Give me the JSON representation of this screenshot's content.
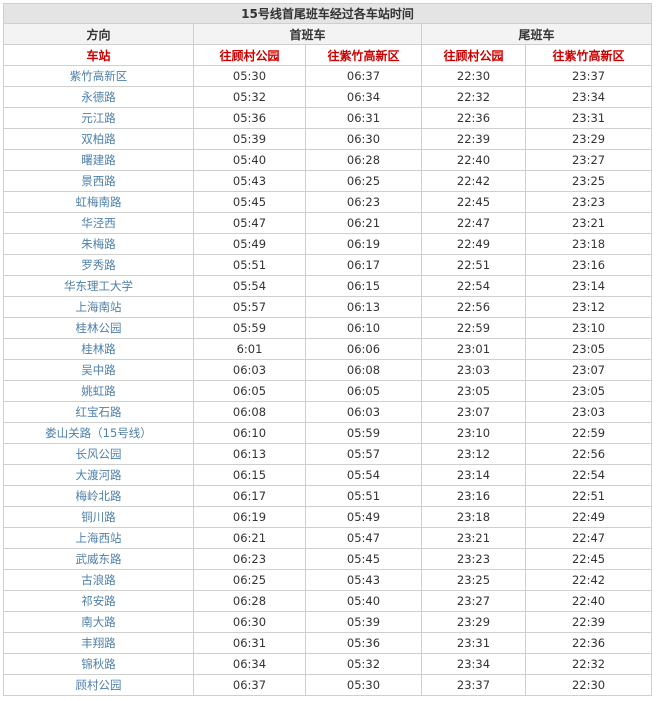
{
  "title": "15号线首尾班车经过各车站时间",
  "header": {
    "direction": "方向",
    "first_train": "首班车",
    "last_train": "尾班车"
  },
  "subheader": {
    "station": "车站",
    "to_gucun": "往顾村公园",
    "to_zizhu": "往紫竹高新区"
  },
  "rows": [
    {
      "station": "紫竹高新区",
      "first_gucun": "05:30",
      "first_zizhu": "06:37",
      "last_gucun": "22:30",
      "last_zizhu": "23:37"
    },
    {
      "station": "永德路",
      "first_gucun": "05:32",
      "first_zizhu": "06:34",
      "last_gucun": "22:32",
      "last_zizhu": "23:34"
    },
    {
      "station": "元江路",
      "first_gucun": "05:36",
      "first_zizhu": "06:31",
      "last_gucun": "22:36",
      "last_zizhu": "23:31"
    },
    {
      "station": "双柏路",
      "first_gucun": "05:39",
      "first_zizhu": "06:30",
      "last_gucun": "22:39",
      "last_zizhu": "23:29"
    },
    {
      "station": "曙建路",
      "first_gucun": "05:40",
      "first_zizhu": "06:28",
      "last_gucun": "22:40",
      "last_zizhu": "23:27"
    },
    {
      "station": "景西路",
      "first_gucun": "05:43",
      "first_zizhu": "06:25",
      "last_gucun": "22:42",
      "last_zizhu": "23:25"
    },
    {
      "station": "虹梅南路",
      "first_gucun": "05:45",
      "first_zizhu": "06:23",
      "last_gucun": "22:45",
      "last_zizhu": "23:23"
    },
    {
      "station": "华泾西",
      "first_gucun": "05:47",
      "first_zizhu": "06:21",
      "last_gucun": "22:47",
      "last_zizhu": "23:21"
    },
    {
      "station": "朱梅路",
      "first_gucun": "05:49",
      "first_zizhu": "06:19",
      "last_gucun": "22:49",
      "last_zizhu": "23:18"
    },
    {
      "station": "罗秀路",
      "first_gucun": "05:51",
      "first_zizhu": "06:17",
      "last_gucun": "22:51",
      "last_zizhu": "23:16"
    },
    {
      "station": "华东理工大学",
      "first_gucun": "05:54",
      "first_zizhu": "06:15",
      "last_gucun": "22:54",
      "last_zizhu": "23:14"
    },
    {
      "station": "上海南站",
      "first_gucun": "05:57",
      "first_zizhu": "06:13",
      "last_gucun": "22:56",
      "last_zizhu": "23:12"
    },
    {
      "station": "桂林公园",
      "first_gucun": "05:59",
      "first_zizhu": "06:10",
      "last_gucun": "22:59",
      "last_zizhu": "23:10"
    },
    {
      "station": "桂林路",
      "first_gucun": "6:01",
      "first_zizhu": "06:06",
      "last_gucun": "23:01",
      "last_zizhu": "23:05"
    },
    {
      "station": "吴中路",
      "first_gucun": "06:03",
      "first_zizhu": "06:08",
      "last_gucun": "23:03",
      "last_zizhu": "23:07"
    },
    {
      "station": "姚虹路",
      "first_gucun": "06:05",
      "first_zizhu": "06:05",
      "last_gucun": "23:05",
      "last_zizhu": "23:05"
    },
    {
      "station": "红宝石路",
      "first_gucun": "06:08",
      "first_zizhu": "06:03",
      "last_gucun": "23:07",
      "last_zizhu": "23:03"
    },
    {
      "station": "娄山关路（15号线）",
      "first_gucun": "06:10",
      "first_zizhu": "05:59",
      "last_gucun": "23:10",
      "last_zizhu": "22:59"
    },
    {
      "station": "长风公园",
      "first_gucun": "06:13",
      "first_zizhu": "05:57",
      "last_gucun": "23:12",
      "last_zizhu": "22:56"
    },
    {
      "station": "大渡河路",
      "first_gucun": "06:15",
      "first_zizhu": "05:54",
      "last_gucun": "23:14",
      "last_zizhu": "22:54"
    },
    {
      "station": "梅岭北路",
      "first_gucun": "06:17",
      "first_zizhu": "05:51",
      "last_gucun": "23:16",
      "last_zizhu": "22:51"
    },
    {
      "station": "铜川路",
      "first_gucun": "06:19",
      "first_zizhu": "05:49",
      "last_gucun": "23:18",
      "last_zizhu": "22:49"
    },
    {
      "station": "上海西站",
      "first_gucun": "06:21",
      "first_zizhu": "05:47",
      "last_gucun": "23:21",
      "last_zizhu": "22:47"
    },
    {
      "station": "武威东路",
      "first_gucun": "06:23",
      "first_zizhu": "05:45",
      "last_gucun": "23:23",
      "last_zizhu": "22:45"
    },
    {
      "station": "古浪路",
      "first_gucun": "06:25",
      "first_zizhu": "05:43",
      "last_gucun": "23:25",
      "last_zizhu": "22:42"
    },
    {
      "station": "祁安路",
      "first_gucun": "06:28",
      "first_zizhu": "05:40",
      "last_gucun": "23:27",
      "last_zizhu": "22:40"
    },
    {
      "station": "南大路",
      "first_gucun": "06:30",
      "first_zizhu": "05:39",
      "last_gucun": "23:29",
      "last_zizhu": "22:39"
    },
    {
      "station": "丰翔路",
      "first_gucun": "06:31",
      "first_zizhu": "05:36",
      "last_gucun": "23:31",
      "last_zizhu": "22:36"
    },
    {
      "station": "锦秋路",
      "first_gucun": "06:34",
      "first_zizhu": "05:32",
      "last_gucun": "23:34",
      "last_zizhu": "22:32"
    },
    {
      "station": "顾村公园",
      "first_gucun": "06:37",
      "first_zizhu": "05:30",
      "last_gucun": "23:37",
      "last_zizhu": "22:30"
    }
  ],
  "colors": {
    "station_link": "#4e7fa8",
    "subheader_red": "#cc0000",
    "title_bg": "#e4e4e4"
  }
}
